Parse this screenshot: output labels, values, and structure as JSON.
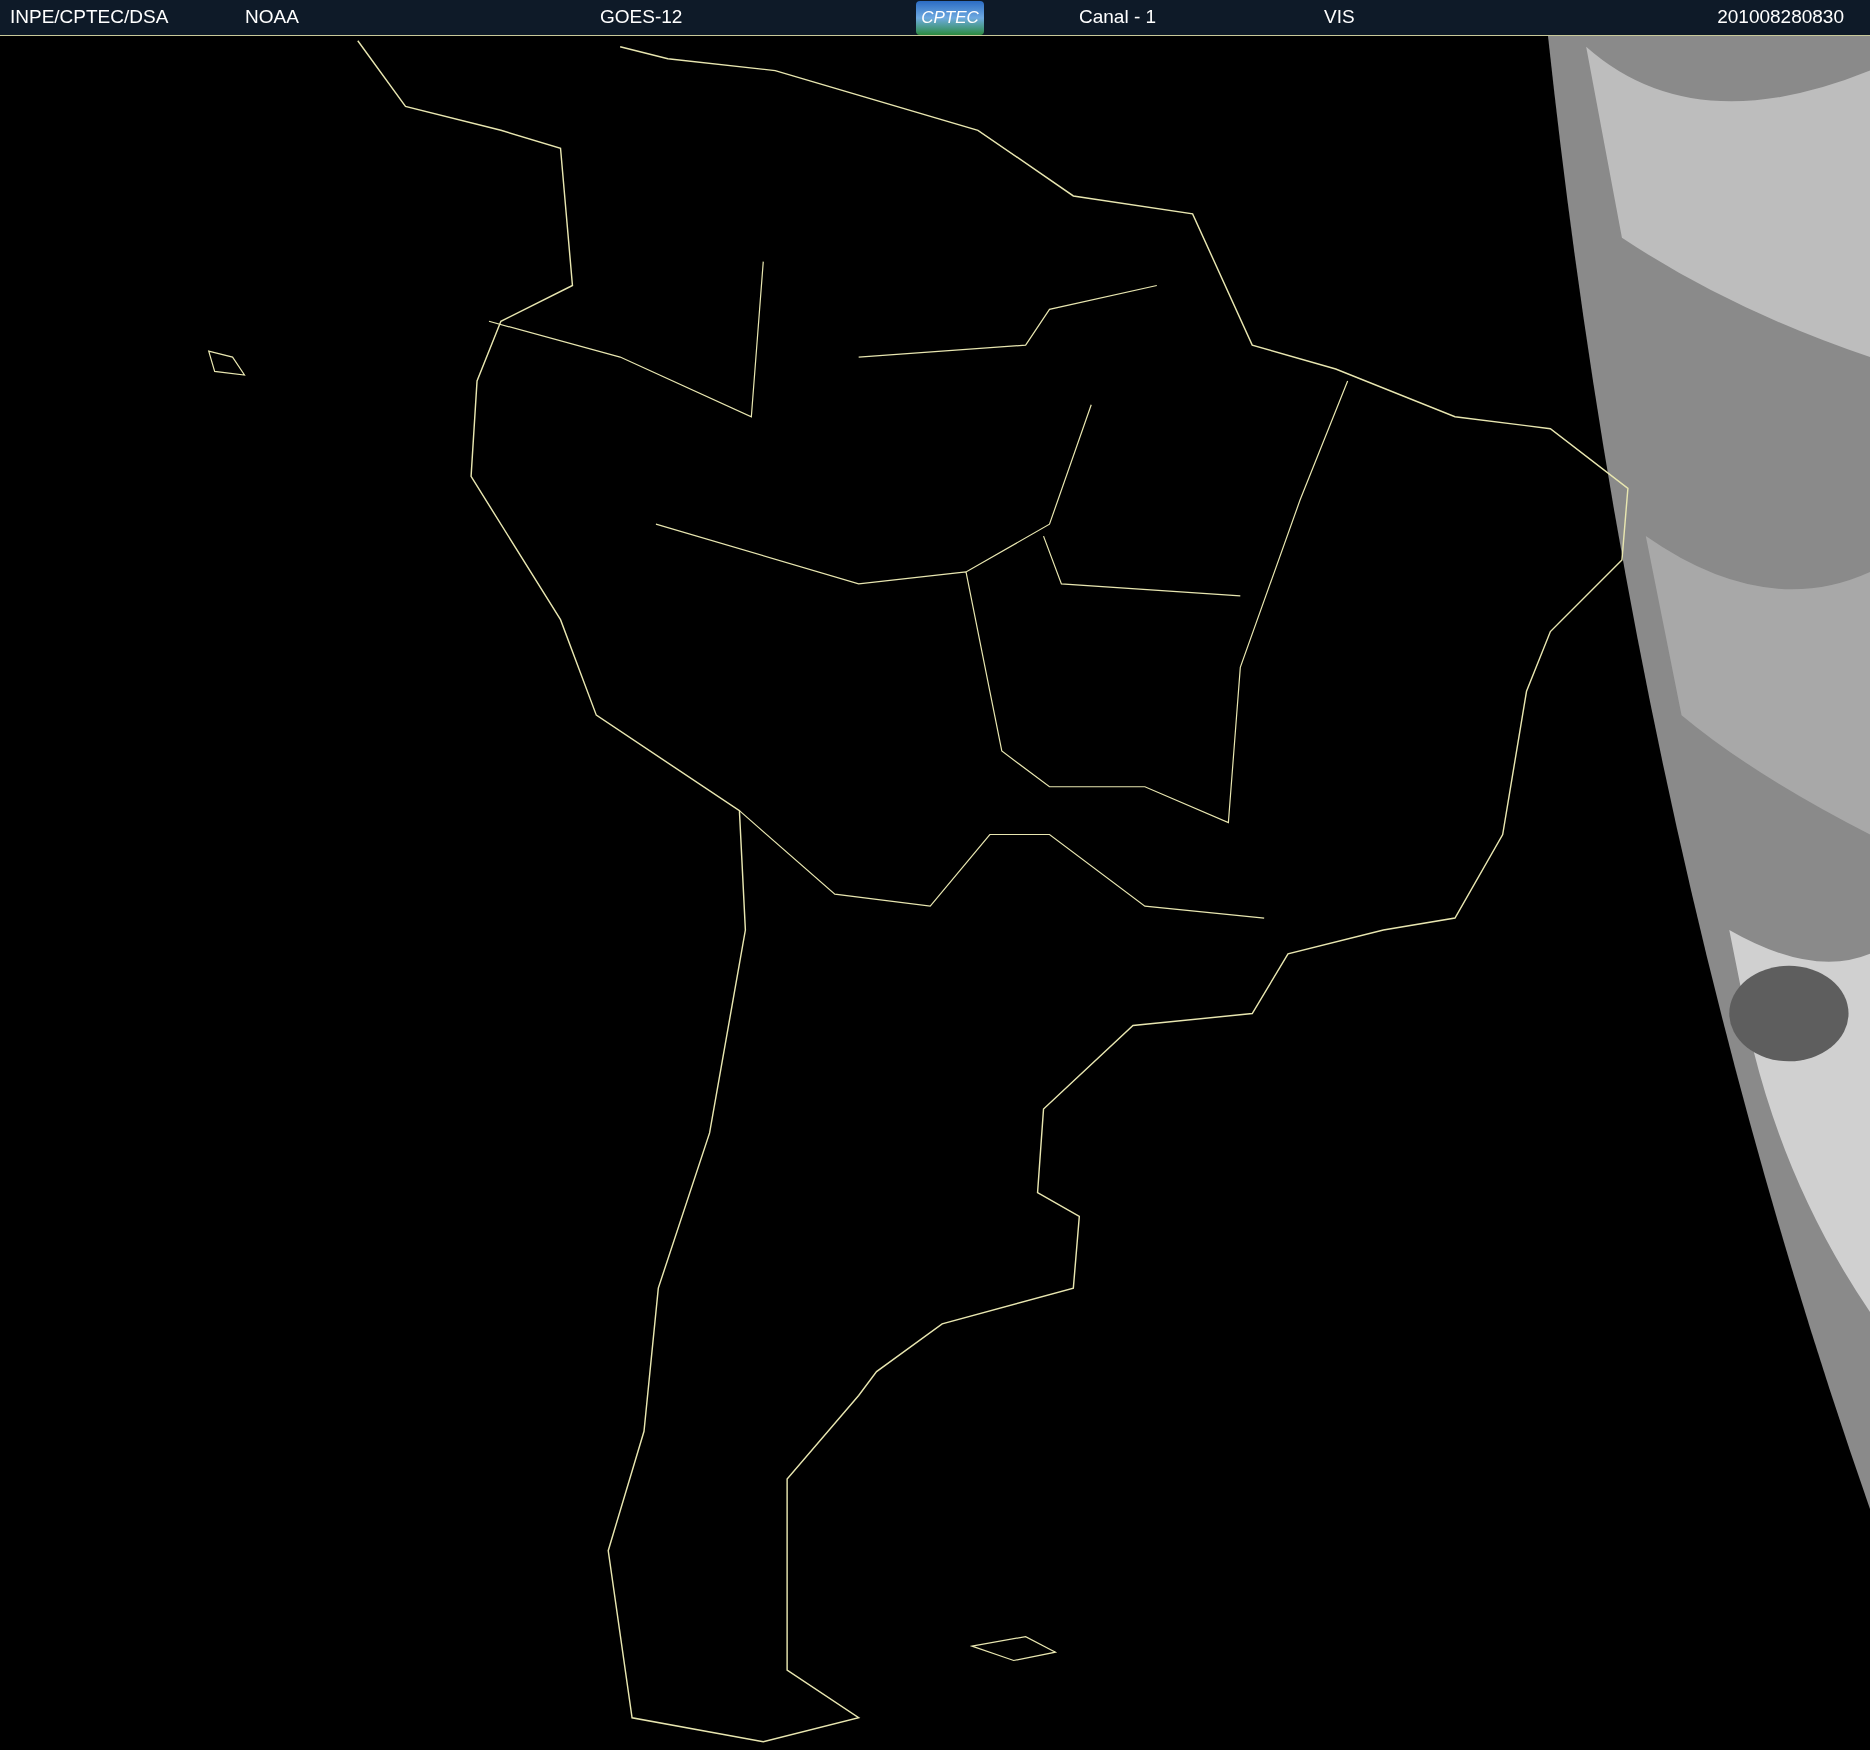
{
  "header": {
    "source": "INPE/CPTEC/DSA",
    "agency": "NOAA",
    "satellite": "GOES-12",
    "logo": "CPTEC",
    "channel": "Canal - 1",
    "band": "VIS",
    "timestamp": "201008280830"
  }
}
